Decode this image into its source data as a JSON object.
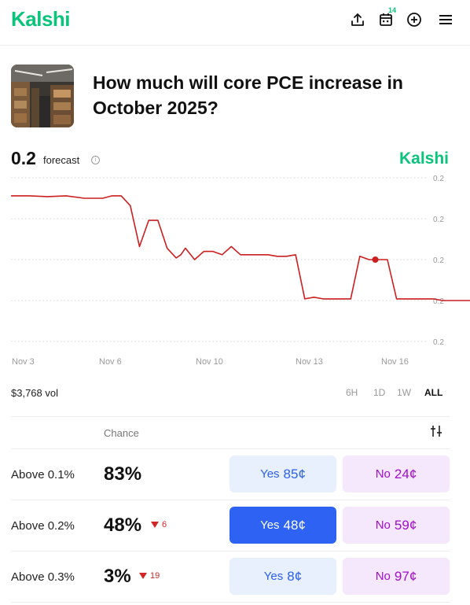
{
  "header": {
    "logo": "Kalshi",
    "icons": [
      "share-icon",
      "calendar-icon",
      "plus-circle-icon",
      "menu-icon"
    ],
    "calendar_badge": "14"
  },
  "market": {
    "title": "How much will core PCE increase in October 2025?"
  },
  "forecast": {
    "value": "0.2",
    "label": "forecast",
    "watermark": "Kalshi"
  },
  "chart_data": {
    "type": "line",
    "y_tick_labels": [
      "0.2",
      "0.2",
      "0.2",
      "0.2",
      "0.2"
    ],
    "x_tick_labels": [
      "Nov 3",
      "Nov 6",
      "Nov 10",
      "Nov 13",
      "Nov 16"
    ],
    "series": [
      {
        "color": "#cc1f1f",
        "x": [
          0,
          2,
          4,
          6,
          8,
          10,
          11,
          12,
          13,
          14,
          15,
          16,
          17,
          18,
          18.5,
          19,
          20,
          21,
          22,
          23,
          24,
          25,
          26,
          27,
          28,
          29,
          30,
          31,
          32,
          33,
          34,
          35,
          36,
          37,
          38,
          39,
          40,
          41,
          42,
          43,
          44,
          45,
          46,
          47,
          48,
          49,
          50
        ],
        "y": [
          0.89,
          0.89,
          0.885,
          0.89,
          0.875,
          0.875,
          0.89,
          0.89,
          0.83,
          0.58,
          0.74,
          0.74,
          0.57,
          0.51,
          0.53,
          0.57,
          0.5,
          0.55,
          0.55,
          0.53,
          0.58,
          0.53,
          0.53,
          0.53,
          0.53,
          0.52,
          0.52,
          0.53,
          0.26,
          0.27,
          0.26,
          0.26,
          0.26,
          0.26,
          0.52,
          0.5,
          0.5,
          0.5,
          0.26,
          0.26,
          0.26,
          0.26,
          0.26,
          0.25,
          0.25,
          0.25,
          0.25
        ]
      }
    ],
    "grid": true,
    "current_point_marker": true
  },
  "volume": "$3,768 vol",
  "ranges": [
    "6H",
    "1D",
    "1W",
    "ALL"
  ],
  "active_range": "ALL",
  "table": {
    "chance_header": "Chance",
    "rows": [
      {
        "label": "Above 0.1%",
        "pct": "83%",
        "delta": "",
        "yes_label": "Yes",
        "yes_price": "85¢",
        "no_label": "No",
        "no_price": "24¢",
        "yes_selected": false
      },
      {
        "label": "Above 0.2%",
        "pct": "48%",
        "delta": "6",
        "yes_label": "Yes",
        "yes_price": "48¢",
        "no_label": "No",
        "no_price": "59¢",
        "yes_selected": true
      },
      {
        "label": "Above 0.3%",
        "pct": "3%",
        "delta": "19",
        "yes_label": "Yes",
        "yes_price": "8¢",
        "no_label": "No",
        "no_price": "97¢",
        "yes_selected": false
      }
    ]
  }
}
